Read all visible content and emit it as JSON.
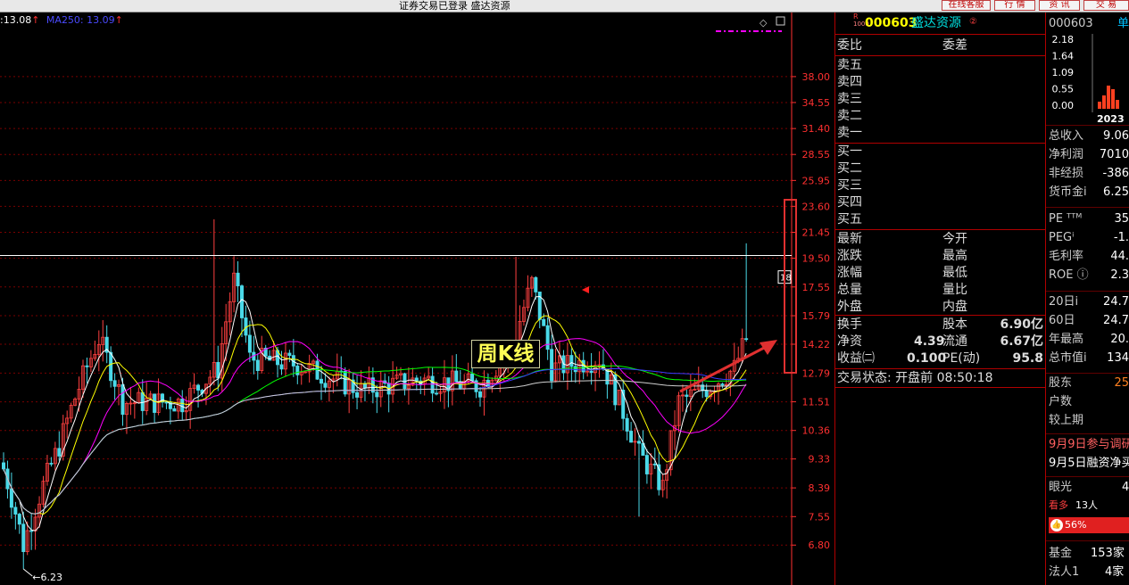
{
  "window": {
    "title": "证券交易已登录 盛达资源",
    "buttons": [
      "在线客服",
      "行 情",
      "资 讯",
      "交 易"
    ]
  },
  "ma_bar": {
    "ma120": ":13.08",
    "ma120_arrow": "↑",
    "ma250": "MA250: 13.09",
    "ma250_arrow": "↑"
  },
  "annotation": {
    "label": "周K线"
  },
  "price_axis": {
    "min_label": "6.23",
    "last_price_marker": "18"
  },
  "chart_data": {
    "type": "candlestick",
    "period": "周K线",
    "y_ticks": [
      38.0,
      34.55,
      31.4,
      28.55,
      25.95,
      23.6,
      21.45,
      19.5,
      17.55,
      15.79,
      14.22,
      12.79,
      11.51,
      10.36,
      9.33,
      8.39,
      7.55,
      6.8
    ],
    "y_scale": "log",
    "ylim": [
      6.25,
      41.5
    ],
    "lowest_low": 6.23,
    "highest_high": 22.5,
    "last_close": 18.2,
    "white_line_value": 19.7,
    "moving_averages": [
      "MA5",
      "MA10",
      "MA20",
      "MA60",
      "MA120",
      "MA250"
    ]
  },
  "colors": {
    "up": "#ff4040",
    "down": "#4ad9e8",
    "grid": "#7a0000",
    "axis": "#ff3030",
    "annotation_box": "#e03030",
    "ma": [
      "#ffffff",
      "#ffff00",
      "#ff00ff",
      "#00ff00",
      "#3a3aff",
      "#d0d0d0"
    ]
  },
  "quote": {
    "code": "000603",
    "name": "盛达资源",
    "badge": "R",
    "sub": "1000",
    "weibi": "委比",
    "weicha": "委差",
    "asks": [
      "卖五",
      "卖四",
      "卖三",
      "卖二",
      "卖一"
    ],
    "bids": [
      "买一",
      "买二",
      "买三",
      "买四",
      "买五"
    ],
    "stats_left": [
      "最新",
      "涨跌",
      "涨幅",
      "总量",
      "外盘"
    ],
    "stats_right": [
      "今开",
      "最高",
      "最低",
      "量比",
      "内盘"
    ],
    "f1": {
      "label": "换手",
      "value": ""
    },
    "f2": {
      "label": "股本",
      "value": "6.90亿"
    },
    "f3": {
      "label": "净资",
      "value": "4.39"
    },
    "f4": {
      "label": "流通",
      "value": "6.67亿"
    },
    "f5": {
      "label": "收益㈡",
      "value": "0.100"
    },
    "f6": {
      "label": "PE(动)",
      "value": "95.8"
    },
    "status": "交易状态: 开盘前 08:50:18"
  },
  "info": {
    "code": "000603",
    "right_head": "单",
    "mini_y": [
      "2.18",
      "1.64",
      "1.09",
      "0.55",
      "0.00"
    ],
    "mini_year": "2023",
    "rows1": [
      {
        "l": "总收入",
        "v": "9.06"
      },
      {
        "l": "净利润",
        "v": "7010"
      },
      {
        "l": "非经损",
        "v": "-386"
      },
      {
        "l": "货币金i",
        "v": "6.25"
      }
    ],
    "rows2": [
      {
        "l": "PE ᵀᵀᴹ",
        "v": "35"
      },
      {
        "l": "PEGⁱ",
        "v": "-1."
      },
      {
        "l": "毛利率",
        "v": "44."
      },
      {
        "l": "ROE ⓘ",
        "v": "2.3"
      }
    ],
    "rows3": [
      {
        "l": "20日i",
        "v": "24.7"
      },
      {
        "l": "60日",
        "v": "24.7"
      },
      {
        "l": "年最高",
        "v": "20."
      },
      {
        "l": "总市值i",
        "v": "134"
      }
    ],
    "rows4": [
      {
        "l": "股东",
        "v": "25"
      },
      {
        "l": "户数",
        "v": ""
      },
      {
        "l": "较上期",
        "v": ""
      }
    ],
    "news": [
      "9月9日参与调研",
      "9月5日融资净买"
    ],
    "eye": "眼光",
    "eye_v": "4",
    "kanduo": "看多",
    "kanduo_v": "13人",
    "pct": "56%",
    "fund": {
      "l": "基金",
      "v": "153家"
    },
    "corp": {
      "l": "法人1",
      "v": "4家"
    }
  }
}
